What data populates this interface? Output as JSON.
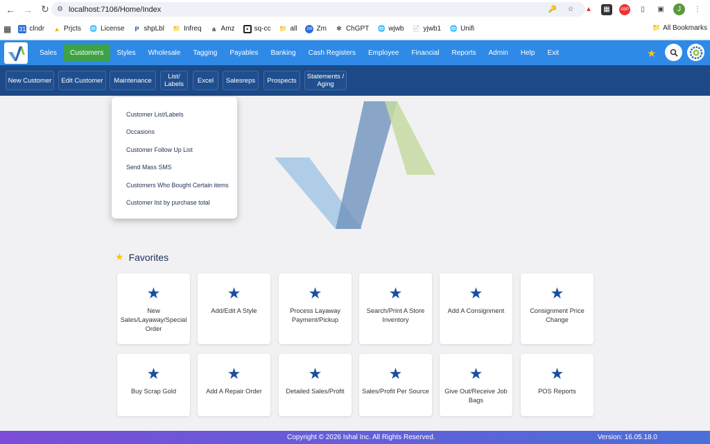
{
  "browser": {
    "url": "localhost:7106/Home/Index",
    "bookmarks": [
      "clndr",
      "Prjcts",
      "License",
      "shpLbl",
      "Infreq",
      "Amz",
      "sq-cc",
      "all",
      "Zm",
      "ChGPT",
      "wjwb",
      "yjwb1",
      "Unifi"
    ],
    "all_bookmarks": "All Bookmarks",
    "profile_initial": "J"
  },
  "topnav": {
    "items": [
      "Sales",
      "Customers",
      "Styles",
      "Wholesale",
      "Tagging",
      "Payables",
      "Banking",
      "Cash Registers",
      "Employee",
      "Financial",
      "Reports",
      "Admin",
      "Help",
      "Exit"
    ],
    "active": "Customers"
  },
  "subnav": {
    "items": [
      "New Customer",
      "Edit Customer",
      "Maintenance",
      "List/ Labels",
      "Excel",
      "Salesreps",
      "Prospects",
      "Statements / Aging"
    ]
  },
  "dropdown": {
    "items": [
      "Customer List/Labels",
      "Occasions",
      "Customer Follow Up List",
      "Send Mass SMS",
      "Customers Who Bought Certain items",
      "Customer list by purchase total"
    ]
  },
  "favorites": {
    "title": "Favorites",
    "tiles": [
      "New Sales/Layaway/Special Order",
      "Add/Edit A Style",
      "Process Layaway Payment/Pickup",
      "Search/Print A Store Inventory",
      "Add A Consignment",
      "Consignment Price Change",
      "Buy Scrap Gold",
      "Add A Repair Order",
      "Detailed Sales/Profit",
      "Sales/Profit Per Source",
      "Give Out/Receive Job Bags",
      "POS Reports"
    ]
  },
  "footer": {
    "copyright": "Copyright © 2026 Ishal Inc. All Rights Reserved.",
    "version": "Version: 16.05.18.0"
  },
  "colors": {
    "topnav": "#2e8ae6",
    "active_tab": "#3fa246",
    "subnav": "#1d4a86",
    "tile_star": "#1a4fa0",
    "fav_star": "#f5c518"
  }
}
